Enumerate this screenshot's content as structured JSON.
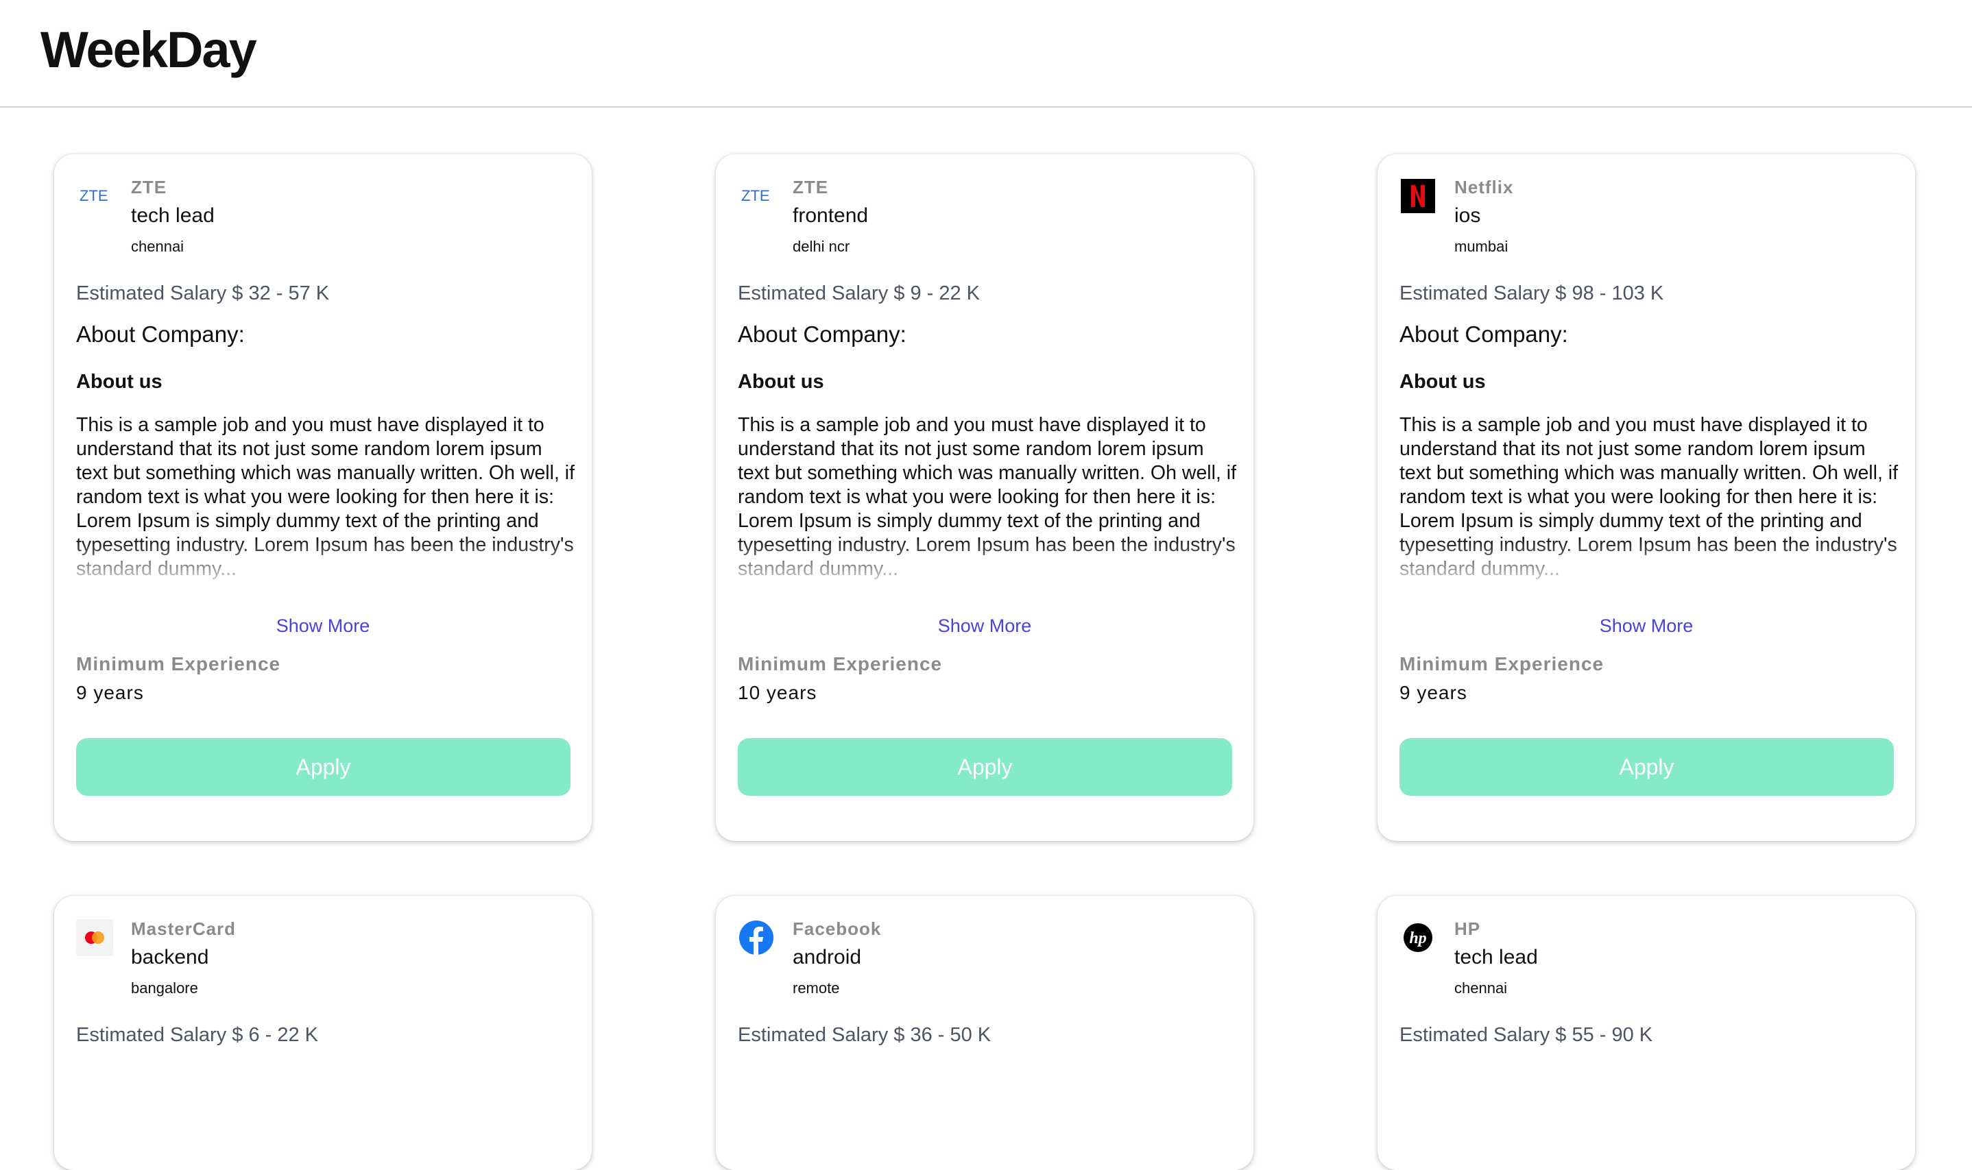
{
  "app": {
    "title": "WeekDay"
  },
  "jobs": [
    {
      "company": "ZTE",
      "logo_icon": "zte-logo",
      "role": "tech lead",
      "location": "chennai",
      "salary": "Estimated Salary $ 32 - 57 K",
      "about_heading": "About Company:",
      "about_sub": "About us",
      "description": "This is a sample job and you must have displayed it to understand that its not just some random lorem ipsum text but something which was manually written. Oh well, if random text is what you were looking for then here it is: Lorem Ipsum is simply dummy text of the printing and typesetting industry. Lorem Ipsum has been the industry's standard dummy...",
      "show_more": "Show More",
      "min_exp_label": "Minimum Experience",
      "min_exp_value": "9 years",
      "apply_label": "Apply"
    },
    {
      "company": "ZTE",
      "logo_icon": "zte-logo",
      "role": "frontend",
      "location": "delhi ncr",
      "salary": "Estimated Salary $ 9 - 22 K",
      "about_heading": "About Company:",
      "about_sub": "About us",
      "description": "This is a sample job and you must have displayed it to understand that its not just some random lorem ipsum text but something which was manually written. Oh well, if random text is what you were looking for then here it is: Lorem Ipsum is simply dummy text of the printing and typesetting industry. Lorem Ipsum has been the industry's standard dummy...",
      "show_more": "Show More",
      "min_exp_label": "Minimum Experience",
      "min_exp_value": "10 years",
      "apply_label": "Apply"
    },
    {
      "company": "Netflix",
      "logo_icon": "netflix-logo",
      "role": "ios",
      "location": "mumbai",
      "salary": "Estimated Salary $ 98 - 103 K",
      "about_heading": "About Company:",
      "about_sub": "About us",
      "description": "This is a sample job and you must have displayed it to understand that its not just some random lorem ipsum text but something which was manually written. Oh well, if random text is what you were looking for then here it is: Lorem Ipsum is simply dummy text of the printing and typesetting industry. Lorem Ipsum has been the industry's standard dummy...",
      "show_more": "Show More",
      "min_exp_label": "Minimum Experience",
      "min_exp_value": "9 years",
      "apply_label": "Apply"
    },
    {
      "company": "MasterCard",
      "logo_icon": "mastercard-logo",
      "role": "backend",
      "location": "bangalore",
      "salary": "Estimated Salary $ 6 - 22 K"
    },
    {
      "company": "Facebook",
      "logo_icon": "facebook-logo",
      "role": "android",
      "location": "remote",
      "salary": "Estimated Salary $ 36 - 50 K"
    },
    {
      "company": "HP",
      "logo_icon": "hp-logo",
      "role": "tech lead",
      "location": "chennai",
      "salary": "Estimated Salary $ 55 - 90 K"
    }
  ],
  "colors": {
    "accent_apply": "#84eac9",
    "link": "#4943da",
    "muted": "#8b8b8b",
    "netflix_red": "#e50914",
    "zte_blue": "#2f6fcf",
    "facebook_blue": "#1877f2"
  }
}
